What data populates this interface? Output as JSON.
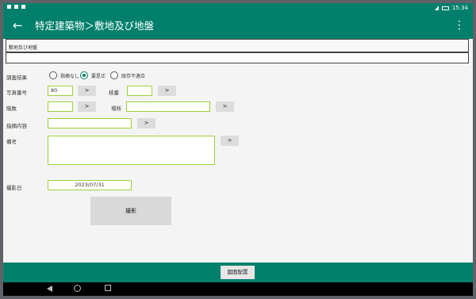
{
  "status_bar": {
    "time": "15:34"
  },
  "app_bar": {
    "title": "特定建築物＞敷地及び地盤",
    "back_icon": "←",
    "menu_icon": "⋮"
  },
  "section": {
    "label": "敷地及び地盤"
  },
  "survey_result": {
    "label": "調査結果",
    "options": [
      {
        "label": "指摘なし",
        "selected": false
      },
      {
        "label": "要是正",
        "selected": true
      },
      {
        "label": "既存不適合",
        "selected": false
      }
    ]
  },
  "photo_number": {
    "label": "写真番号",
    "value": "80"
  },
  "branch_number": {
    "label": "枝番",
    "value": ""
  },
  "floor": {
    "label": "階数",
    "value": ""
  },
  "location": {
    "label": "場所",
    "value": ""
  },
  "finding": {
    "label": "指摘内容",
    "value": ""
  },
  "remarks": {
    "label": "備考",
    "value": ""
  },
  "shoot_date": {
    "label": "撮影日",
    "value": "2023/07/31"
  },
  "buttons": {
    "picker": ">",
    "capture": "撮影",
    "diagram": "図面配置"
  },
  "colors": {
    "primary": "#00806c",
    "field_border": "#9fcf3c"
  }
}
